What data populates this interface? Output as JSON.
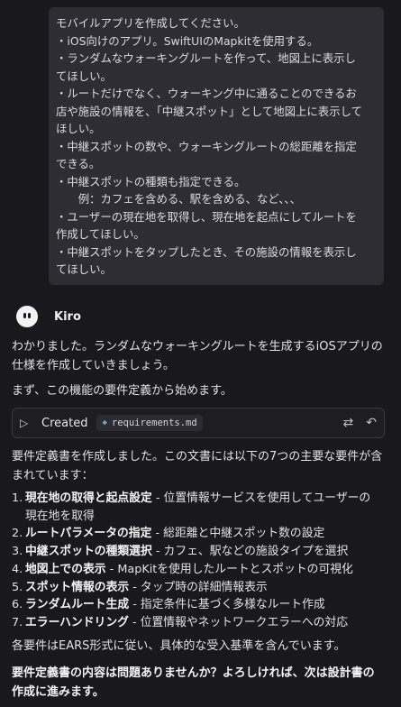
{
  "user_message": {
    "lines": [
      "モバイルアプリを作成してください。",
      "・iOS向けのアプリ。SwiftUIのMapkitを使用する。",
      "・ランダムなウォーキングルートを作って、地図上に表示し",
      "てほしい。",
      "・ルートだけでなく、ウォーキング中に通ることのできるお",
      "店や施設の情報を、「中継スポット」として地図上に表示して",
      "ほしい。",
      "・中継スポットの数や、ウォーキングルートの総距離を指定",
      "できる。",
      "・中継スポットの種類も指定できる。",
      "　　例：カフェを含める、駅を含める、など、、、",
      "・ユーザーの現在地を取得し、現在地を起点にしてルートを",
      "作成してほしい。",
      "・中継スポットをタップしたとき、その施設の情報を表示し",
      "てほしい。"
    ]
  },
  "agent": {
    "name": "Kiro",
    "intro_line1": "わかりました。ランダムなウォーキングルートを生成するiOSアプリの",
    "intro_line2": "仕様を作成していきましょう。",
    "start": "まず、この機能の要件定義から始めます。",
    "created": {
      "label": "Created",
      "file": "requirements.md",
      "file_icon": "markdown-file-icon",
      "actions": [
        "compare-icon",
        "undo-icon"
      ]
    },
    "summary_line1": "要件定義書を作成しました。この文書には以下の7つの主要な要件が含",
    "summary_line2": "まれています：",
    "requirements": [
      {
        "num": "1.",
        "title": "現在地の取得と起点設定",
        "desc": " - 位置情報サービスを使用してユーザーの",
        "cont": "現在地を取得"
      },
      {
        "num": "2.",
        "title": "ルートパラメータの指定",
        "desc": " - 総距離と中継スポット数の設定",
        "cont": ""
      },
      {
        "num": "3.",
        "title": "中継スポットの種類選択",
        "desc": " - カフェ、駅などの施設タイプを選択",
        "cont": ""
      },
      {
        "num": "4.",
        "title": "地図上での表示",
        "desc": " - MapKitを使用したルートとスポットの可視化",
        "cont": ""
      },
      {
        "num": "5.",
        "title": "スポット情報の表示",
        "desc": " - タップ時の詳細情報表示",
        "cont": ""
      },
      {
        "num": "6.",
        "title": "ランダムルート生成",
        "desc": " - 指定条件に基づく多様なルート作成",
        "cont": ""
      },
      {
        "num": "7.",
        "title": "エラーハンドリング",
        "desc": " - 位置情報やネットワークエラーへの対応",
        "cont": ""
      }
    ],
    "ears_note": "各要件はEARS形式に従い、具体的な受入基準を含んでいます。",
    "question_line1": "要件定義書の内容は問題ありませんか？よろしければ、次は設計書の",
    "question_line2": "作成に進みます。"
  }
}
